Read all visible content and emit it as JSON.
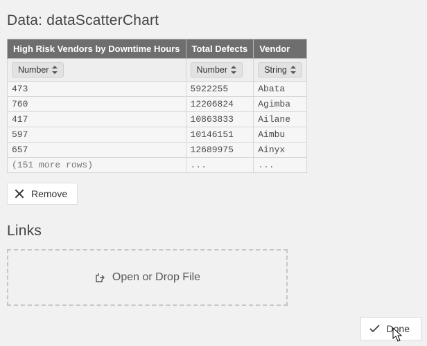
{
  "titles": {
    "data_section": "Data: dataScatterChart",
    "links_section": "Links"
  },
  "table": {
    "columns": [
      {
        "header": "High Risk Vendors by Downtime Hours",
        "type_label": "Number"
      },
      {
        "header": "Total Defects",
        "type_label": "Number"
      },
      {
        "header": "Vendor",
        "type_label": "String"
      }
    ],
    "rows": [
      {
        "c0": "473",
        "c1": "5922255",
        "c2": "Abata"
      },
      {
        "c0": "760",
        "c1": "12206824",
        "c2": "Agimba"
      },
      {
        "c0": "417",
        "c1": "10863833",
        "c2": "Ailane"
      },
      {
        "c0": "597",
        "c1": "10146151",
        "c2": "Aimbu"
      },
      {
        "c0": "657",
        "c1": "12689975",
        "c2": "Ainyx"
      }
    ],
    "more_rows_label": "(151 more rows)",
    "ellipsis": "..."
  },
  "buttons": {
    "remove": "Remove",
    "open_or_drop": "Open or Drop File",
    "done": "Done"
  }
}
